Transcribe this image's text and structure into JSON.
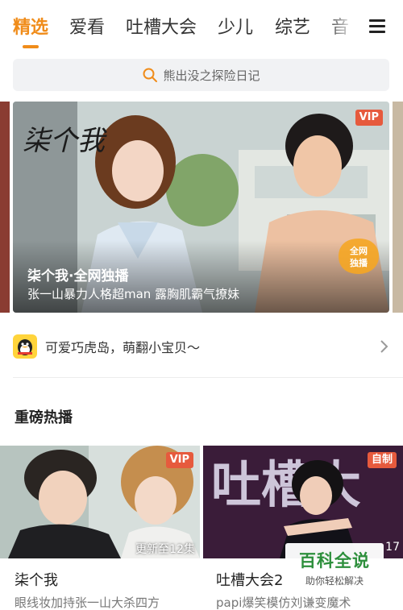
{
  "tabs": [
    {
      "label": "精选",
      "active": true
    },
    {
      "label": "爱看",
      "active": false
    },
    {
      "label": "吐槽大会",
      "active": false
    },
    {
      "label": "少儿",
      "active": false
    },
    {
      "label": "综艺",
      "active": false
    },
    {
      "label": "音",
      "active": false
    }
  ],
  "search": {
    "placeholder": "熊出没之探险日记",
    "icon": "search-icon"
  },
  "banner": {
    "logo_text": "柒个我",
    "title": "柒个我·全网独播",
    "subtitle": "张一山暴力人格超man 露胸肌霸气撩妹",
    "badge": "VIP",
    "seal_line1": "全网",
    "seal_line2": "独播"
  },
  "notice": {
    "text": "可爱巧虎岛，萌翻小宝贝～",
    "icon": "qq-penguin-icon"
  },
  "section": {
    "title": "重磅热播"
  },
  "cards": [
    {
      "title": "柒个我",
      "desc": "眼线妆加持张一山大杀四方",
      "badge": "VIP",
      "update": "更新至12集"
    },
    {
      "title": "吐槽大会2",
      "desc": "papi爆笑模仿刘谦变魔术",
      "badge": "自制",
      "count": "17",
      "art_text": "吐槽大"
    }
  ],
  "watermark": {
    "big": "百科全说",
    "small": "助你轻松解决"
  },
  "colors": {
    "accent": "#f08c1a",
    "vip": "#e65a3d",
    "watermark_green": "#2d8f3c"
  }
}
